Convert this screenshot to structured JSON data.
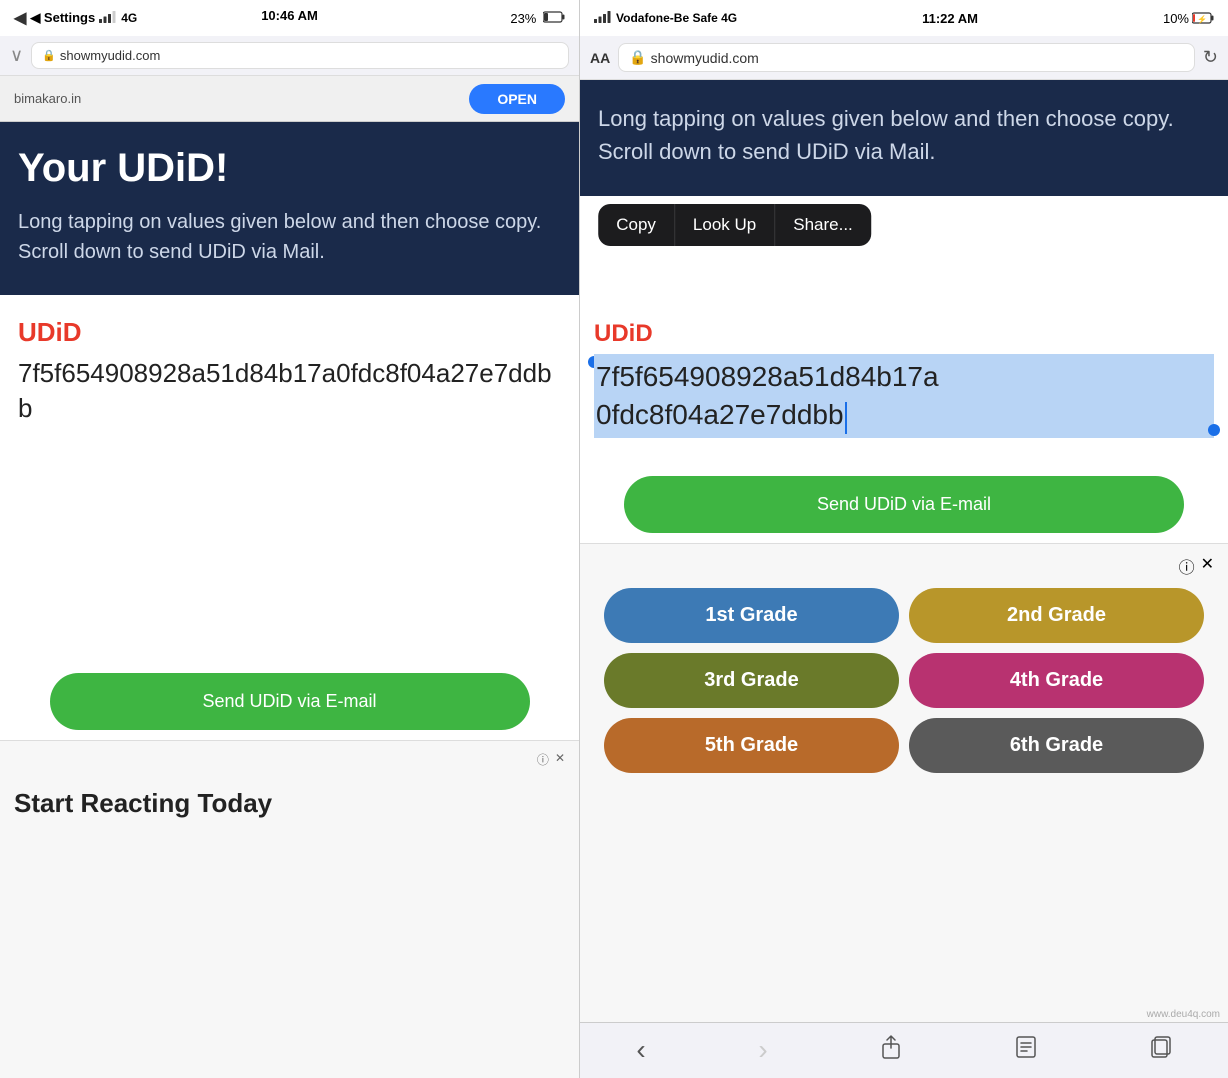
{
  "left_phone": {
    "status_bar": {
      "left_text": "◀ Settings",
      "signal_label": "4G",
      "time": "10:46 AM",
      "battery": "23%"
    },
    "browser_bar": {
      "url": "showmyudid.com",
      "lock_icon": "🔒"
    },
    "ad_banner": {
      "site": "bimakaro.in",
      "open_label": "OPEN"
    },
    "dark_section": {
      "title": "Your UDiD!",
      "instruction": "Long tapping on values given below and then choose copy. Scroll down to send UDiD via Mail."
    },
    "white_section": {
      "udid_label": "UDiD",
      "udid_value": "7f5f654908928a51d84b17a0fdc8f04a27e7ddbb"
    },
    "send_button": "Send UDiD via E-mail",
    "ad_bottom": {
      "info_icon": "ⓘ",
      "close_icon": "✕",
      "title": "Start Reacting Today"
    }
  },
  "right_phone": {
    "status_bar": {
      "signal_label": "Vodafone-Be Safe  4G",
      "time": "11:22 AM",
      "battery": "10%"
    },
    "browser_bar": {
      "aa_label": "AA",
      "url": "showmyudid.com",
      "lock_icon": "🔒",
      "refresh_icon": "↻"
    },
    "dark_section": {
      "instruction": "Long tapping on values given below and then choose copy. Scroll down to send UDiD via Mail."
    },
    "context_menu": {
      "copy": "Copy",
      "look_up": "Look Up",
      "share": "Share..."
    },
    "white_section": {
      "udid_label": "UDiD",
      "udid_value_line1": "7f5f654908928a51d84b17a",
      "udid_value_line2": "0fdc8f04a27e7ddbb"
    },
    "send_button": "Send UDiD via E-mail",
    "grade_buttons": [
      {
        "label": "1st Grade",
        "color_class": "grade-btn-1"
      },
      {
        "label": "2nd Grade",
        "color_class": "grade-btn-2"
      },
      {
        "label": "3rd Grade",
        "color_class": "grade-btn-3"
      },
      {
        "label": "4th Grade",
        "color_class": "grade-btn-4"
      },
      {
        "label": "5th Grade",
        "color_class": "grade-btn-5"
      },
      {
        "label": "6th Grade",
        "color_class": "grade-btn-6"
      }
    ],
    "ad_header": {
      "info_icon": "ⓘ",
      "close_icon": "✕"
    },
    "watermark": "www.deu4q.com",
    "bottom_toolbar": {
      "back": "‹",
      "forward": "›",
      "share": "⬆",
      "bookmarks": "📖",
      "tabs": "⧉"
    }
  }
}
